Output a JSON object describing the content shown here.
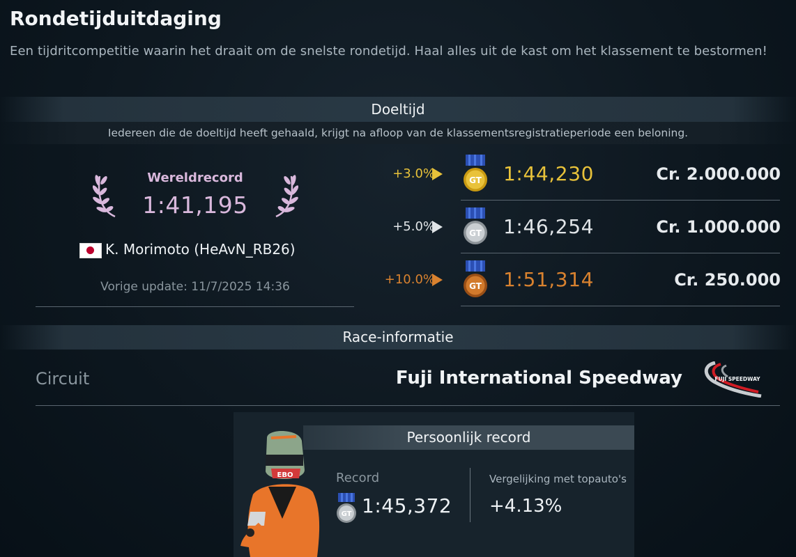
{
  "header": {
    "title": "Rondetijduitdaging",
    "description": "Een tijdritcompetitie waarin het draait om de snelste rondetijd. Haal alles uit de kast om het klassement te bestormen!"
  },
  "target_section": {
    "title": "Doeltijd",
    "subtitle": "Iedereen die de doeltijd heeft gehaald, krijgt na afloop van de klassementsregistratieperiode een beloning."
  },
  "world_record": {
    "label": "Wereldrecord",
    "time": "1:41,195",
    "driver": "K. Morimoto (HeAvN_RB26)",
    "last_update": "Vorige update: 11/7/2025 14:36"
  },
  "tiers": [
    {
      "percent": "+3.0%",
      "time": "1:44,230",
      "reward": "Cr.  2.000.000",
      "medal": "gold"
    },
    {
      "percent": "+5.0%",
      "time": "1:46,254",
      "reward": "Cr.  1.000.000",
      "medal": "silver"
    },
    {
      "percent": "+10.0%",
      "time": "1:51,314",
      "reward": "Cr.  250.000",
      "medal": "bronze"
    }
  ],
  "race_info": {
    "title": "Race-informatie",
    "circuit_label": "Circuit",
    "circuit_name": "Fuji International Speedway",
    "circuit_logo_text": "FUJI SPEEDWAY"
  },
  "personal_record": {
    "title": "Persoonlijk record",
    "record_label": "Record",
    "record_value": "1:45,372",
    "record_medal": "silver",
    "compare_label": "Vergelijking met topauto's",
    "compare_value": "+4.13%"
  },
  "colors": {
    "gold": "#e8c23a",
    "silver": "#e1e5e8",
    "bronze": "#d9822f",
    "world_record": "#d9b8dc"
  }
}
